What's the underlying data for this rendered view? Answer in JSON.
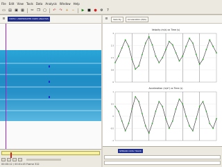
{
  "menu": {
    "items": [
      "File",
      "Edit",
      "View",
      "Tools",
      "Data",
      "Analysis",
      "Window",
      "Help"
    ]
  },
  "toolbar": {
    "buttons": [
      "new-icon",
      "open-icon",
      "save-icon",
      "print-icon",
      "cut-icon",
      "copy-icon",
      "paste-icon",
      "undo-icon",
      "redo-icon",
      "zoom-in-icon",
      "zoom-out-icon",
      "play-icon",
      "stop-icon",
      "record-icon",
      "settings-icon",
      "help-icon"
    ]
  },
  "left_panel": {
    "title": "VIDEO: UNDERWATER SWIM ANALYSIS",
    "status": "00:00:12 / 00:01:45  Frame 312"
  },
  "right_panel": {
    "tab1": "Velocity",
    "tab2": "Acceleration (N/A)",
    "bottom_title": "SENSOR DATA TRACK"
  },
  "chart_data": [
    {
      "type": "line",
      "title": "Velocity (m/s) vs Time (s)",
      "x": [
        0,
        1,
        2,
        3,
        4,
        5,
        6,
        7,
        8,
        9,
        10,
        11,
        12,
        13,
        14,
        15,
        16,
        17,
        18,
        19,
        20,
        21,
        22,
        23,
        24,
        25,
        26,
        27,
        28,
        29,
        30
      ],
      "series": [
        {
          "name": "",
          "values": [
            1.2,
            1.6,
            2.1,
            2.6,
            2.2,
            1.4,
            0.8,
            1.0,
            1.7,
            2.4,
            2.8,
            2.3,
            1.6,
            1.2,
            1.5,
            2.0,
            2.5,
            2.3,
            1.8,
            1.3,
            1.6,
            2.2,
            2.7,
            2.4,
            1.7,
            1.1,
            1.4,
            2.0,
            2.6,
            2.2,
            1.8
          ]
        }
      ],
      "ylim": [
        0,
        3
      ],
      "grid": true
    },
    {
      "type": "line",
      "title": "Acceleration (m/s²) vs Time (s)",
      "x": [
        0,
        1,
        2,
        3,
        4,
        5,
        6,
        7,
        8,
        9,
        10,
        11,
        12,
        13,
        14,
        15,
        16,
        17,
        18,
        19,
        20,
        21,
        22,
        23,
        24,
        25,
        26,
        27,
        28,
        29,
        30
      ],
      "series": [
        {
          "name": "",
          "values": [
            0.4,
            0.2,
            -0.2,
            -0.6,
            -0.3,
            0.3,
            0.8,
            0.6,
            0.1,
            -0.4,
            -0.7,
            -0.3,
            0.2,
            0.6,
            0.4,
            -0.1,
            -0.5,
            -0.2,
            0.3,
            0.7,
            0.5,
            0.0,
            -0.4,
            -0.6,
            -0.1,
            0.4,
            0.6,
            0.2,
            -0.3,
            -0.5,
            -0.1
          ]
        }
      ],
      "ylim": [
        -1,
        1
      ],
      "grid": true
    }
  ],
  "colors": {
    "accent": "#1f2e8a",
    "series_line": "#2a2a2a",
    "series_point": "#20b020",
    "marker_line": "#a020c0",
    "playhead": "#d02020"
  }
}
